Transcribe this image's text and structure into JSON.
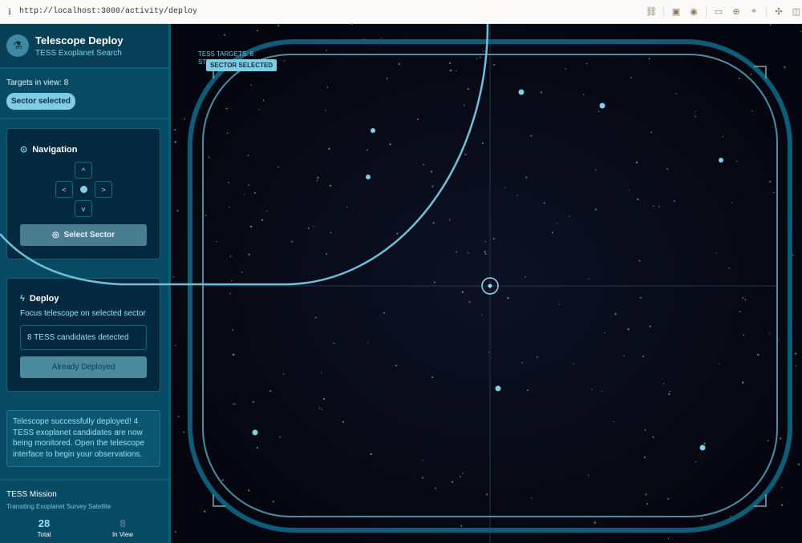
{
  "browser": {
    "url": "http://localhost:3000/activity/deploy",
    "info_icon": "i"
  },
  "header": {
    "title": "Telescope Deploy",
    "subtitle": "TESS Exoplanet Search"
  },
  "status": {
    "targets_in_view": "Targets in view: 8",
    "pill": "Sector selected"
  },
  "navigation": {
    "title": "Navigation",
    "up": "^",
    "left": "<",
    "right": ">",
    "down": "v",
    "select_label": "Select Sector"
  },
  "deploy": {
    "title": "Deploy",
    "description": "Focus telescope on selected sector",
    "candidates": "8 TESS candidates detected",
    "button": "Already Deployed"
  },
  "message": "Telescope successfully deployed! 4 TESS exoplanet candidates are now being monitored. Open the telescope interface to begin your observations.",
  "mission": {
    "title": "TESS Mission",
    "subtitle": "Transiting Exoplanet Survey Satellite",
    "total_value": "28",
    "total_label": "Total",
    "inview_value": "8",
    "inview_label": "In View"
  },
  "view": {
    "targets_label": "TESS TARGETS: 8",
    "status_partial": "ST",
    "sector_tag": "SECTOR SELECTED"
  },
  "colors": {
    "accent": "#7fcde4",
    "sidebar": "#074a63",
    "space": "#05060f"
  }
}
